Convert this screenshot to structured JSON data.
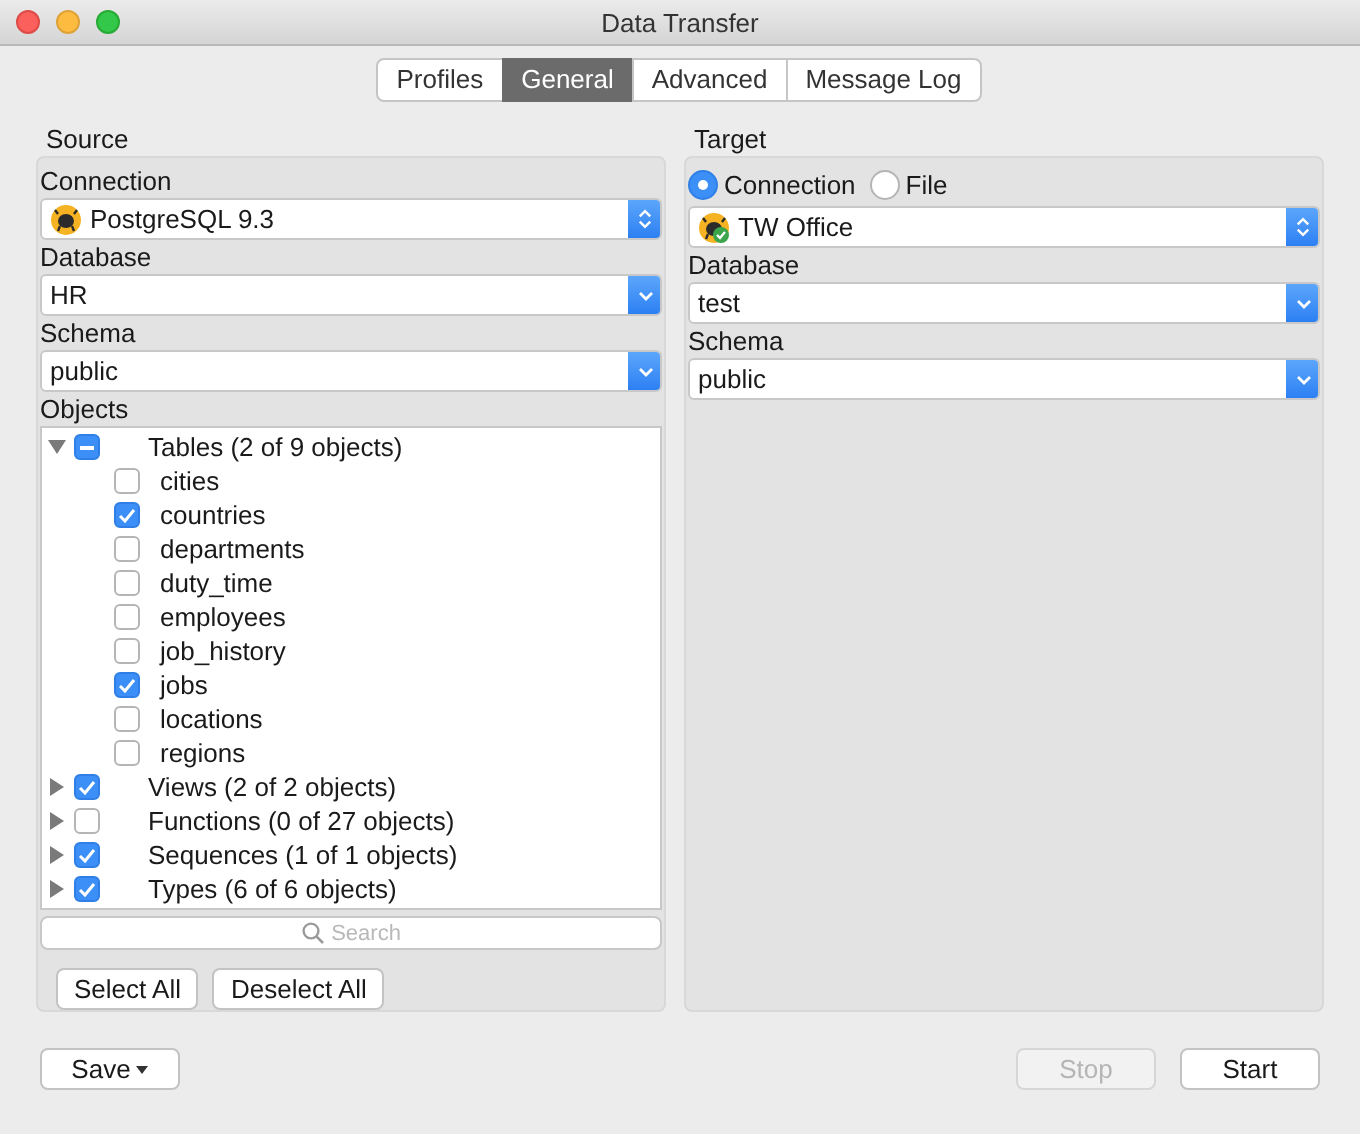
{
  "window": {
    "title": "Data Transfer"
  },
  "tabs": [
    {
      "label": "Profiles",
      "selected": false
    },
    {
      "label": "General",
      "selected": true
    },
    {
      "label": "Advanced",
      "selected": false
    },
    {
      "label": "Message Log",
      "selected": false
    }
  ],
  "source": {
    "title": "Source",
    "connection_label": "Connection",
    "connection": "PostgreSQL 9.3",
    "database_label": "Database",
    "database": "HR",
    "schema_label": "Schema",
    "schema": "public",
    "objects_label": "Objects",
    "objects": [
      {
        "label": "Tables (2 of 9 objects)",
        "expanded": true,
        "mixed": true,
        "children": [
          {
            "label": "cities",
            "checked": false
          },
          {
            "label": "countries",
            "checked": true
          },
          {
            "label": "departments",
            "checked": false
          },
          {
            "label": "duty_time",
            "checked": false
          },
          {
            "label": "employees",
            "checked": false
          },
          {
            "label": "job_history",
            "checked": false
          },
          {
            "label": "jobs",
            "checked": true
          },
          {
            "label": "locations",
            "checked": false
          },
          {
            "label": "regions",
            "checked": false
          }
        ]
      },
      {
        "label": "Views (2 of 2 objects)",
        "expanded": false,
        "checked": true
      },
      {
        "label": "Functions (0 of 27 objects)",
        "expanded": false,
        "checked": false
      },
      {
        "label": "Sequences (1 of 1 objects)",
        "expanded": false,
        "checked": true
      },
      {
        "label": "Types (6 of 6 objects)",
        "expanded": false,
        "checked": true
      }
    ],
    "search": {
      "placeholder": "Search"
    },
    "buttons": [
      {
        "label": "Select All"
      },
      {
        "label": "Deselect All"
      }
    ]
  },
  "target": {
    "title": "Target",
    "modes": [
      {
        "label": "Connection",
        "selected": true
      },
      {
        "label": "File",
        "selected": false
      }
    ],
    "connection": "TW Office",
    "database_label": "Database",
    "database": "test",
    "schema_label": "Schema",
    "schema": "public"
  },
  "footer": {
    "save": "Save",
    "buttons": [
      {
        "label": "Stop",
        "disabled": true
      },
      {
        "label": "Start",
        "disabled": false
      }
    ]
  }
}
